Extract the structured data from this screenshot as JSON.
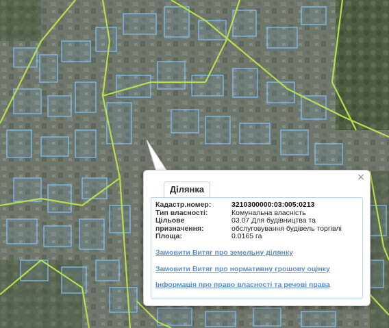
{
  "popup": {
    "tab_label": "Ділянка",
    "close_glyph": "×",
    "fields": [
      {
        "label": "Кадастр.номер:",
        "value": "3210300000:03:005:0213",
        "strong": true
      },
      {
        "label": "Тип власності:",
        "value": "Комунальна власність",
        "strong": false
      },
      {
        "label": "Цільове призначення:",
        "value": "03.07 Для будівництва та обслуговування будівель торгівлі",
        "strong": false
      },
      {
        "label": "Площа:",
        "value": "0.0165 га",
        "strong": false
      }
    ],
    "links": [
      "Замовити Витяг про земельну ділянку",
      "Замовити Витяг про нормативну грошову оцінку",
      "Інформація про право власності та речові права"
    ]
  },
  "colors": {
    "parcel_outline": "#7fc4ff",
    "road_line": "#b6e04a",
    "link": "#5b8fd0",
    "popup_border": "#b7d3ef"
  }
}
